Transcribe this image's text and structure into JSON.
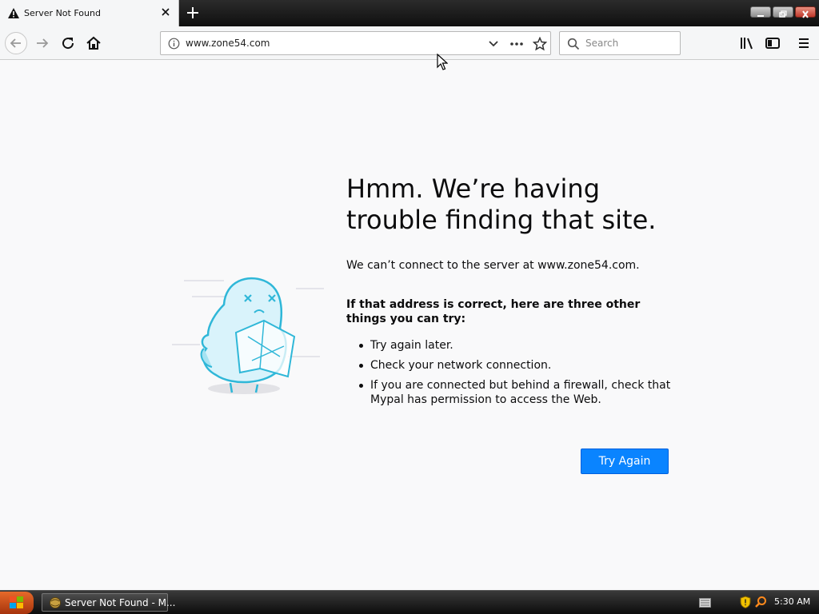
{
  "tab": {
    "title": "Server Not Found"
  },
  "navbar": {
    "url": "www.zone54.com",
    "search_placeholder": "Search"
  },
  "error": {
    "heading": "Hmm. We’re having trouble finding that site.",
    "description": "We can’t connect to the server at www.zone54.com.",
    "suggestions_title": "If that address is correct, here are three other things you can try:",
    "suggestions": [
      "Try again later.",
      "Check your network connection.",
      "If you are connected but behind a firewall, check that Mypal has permission to access the Web."
    ],
    "button_label": "Try Again"
  },
  "taskbar": {
    "task_label": "Server Not Found - M...",
    "clock": "5:30 AM"
  },
  "colors": {
    "accent": "#0a84ff",
    "page_bg": "#f9f9fa",
    "illustration": "#2fb7d8"
  }
}
